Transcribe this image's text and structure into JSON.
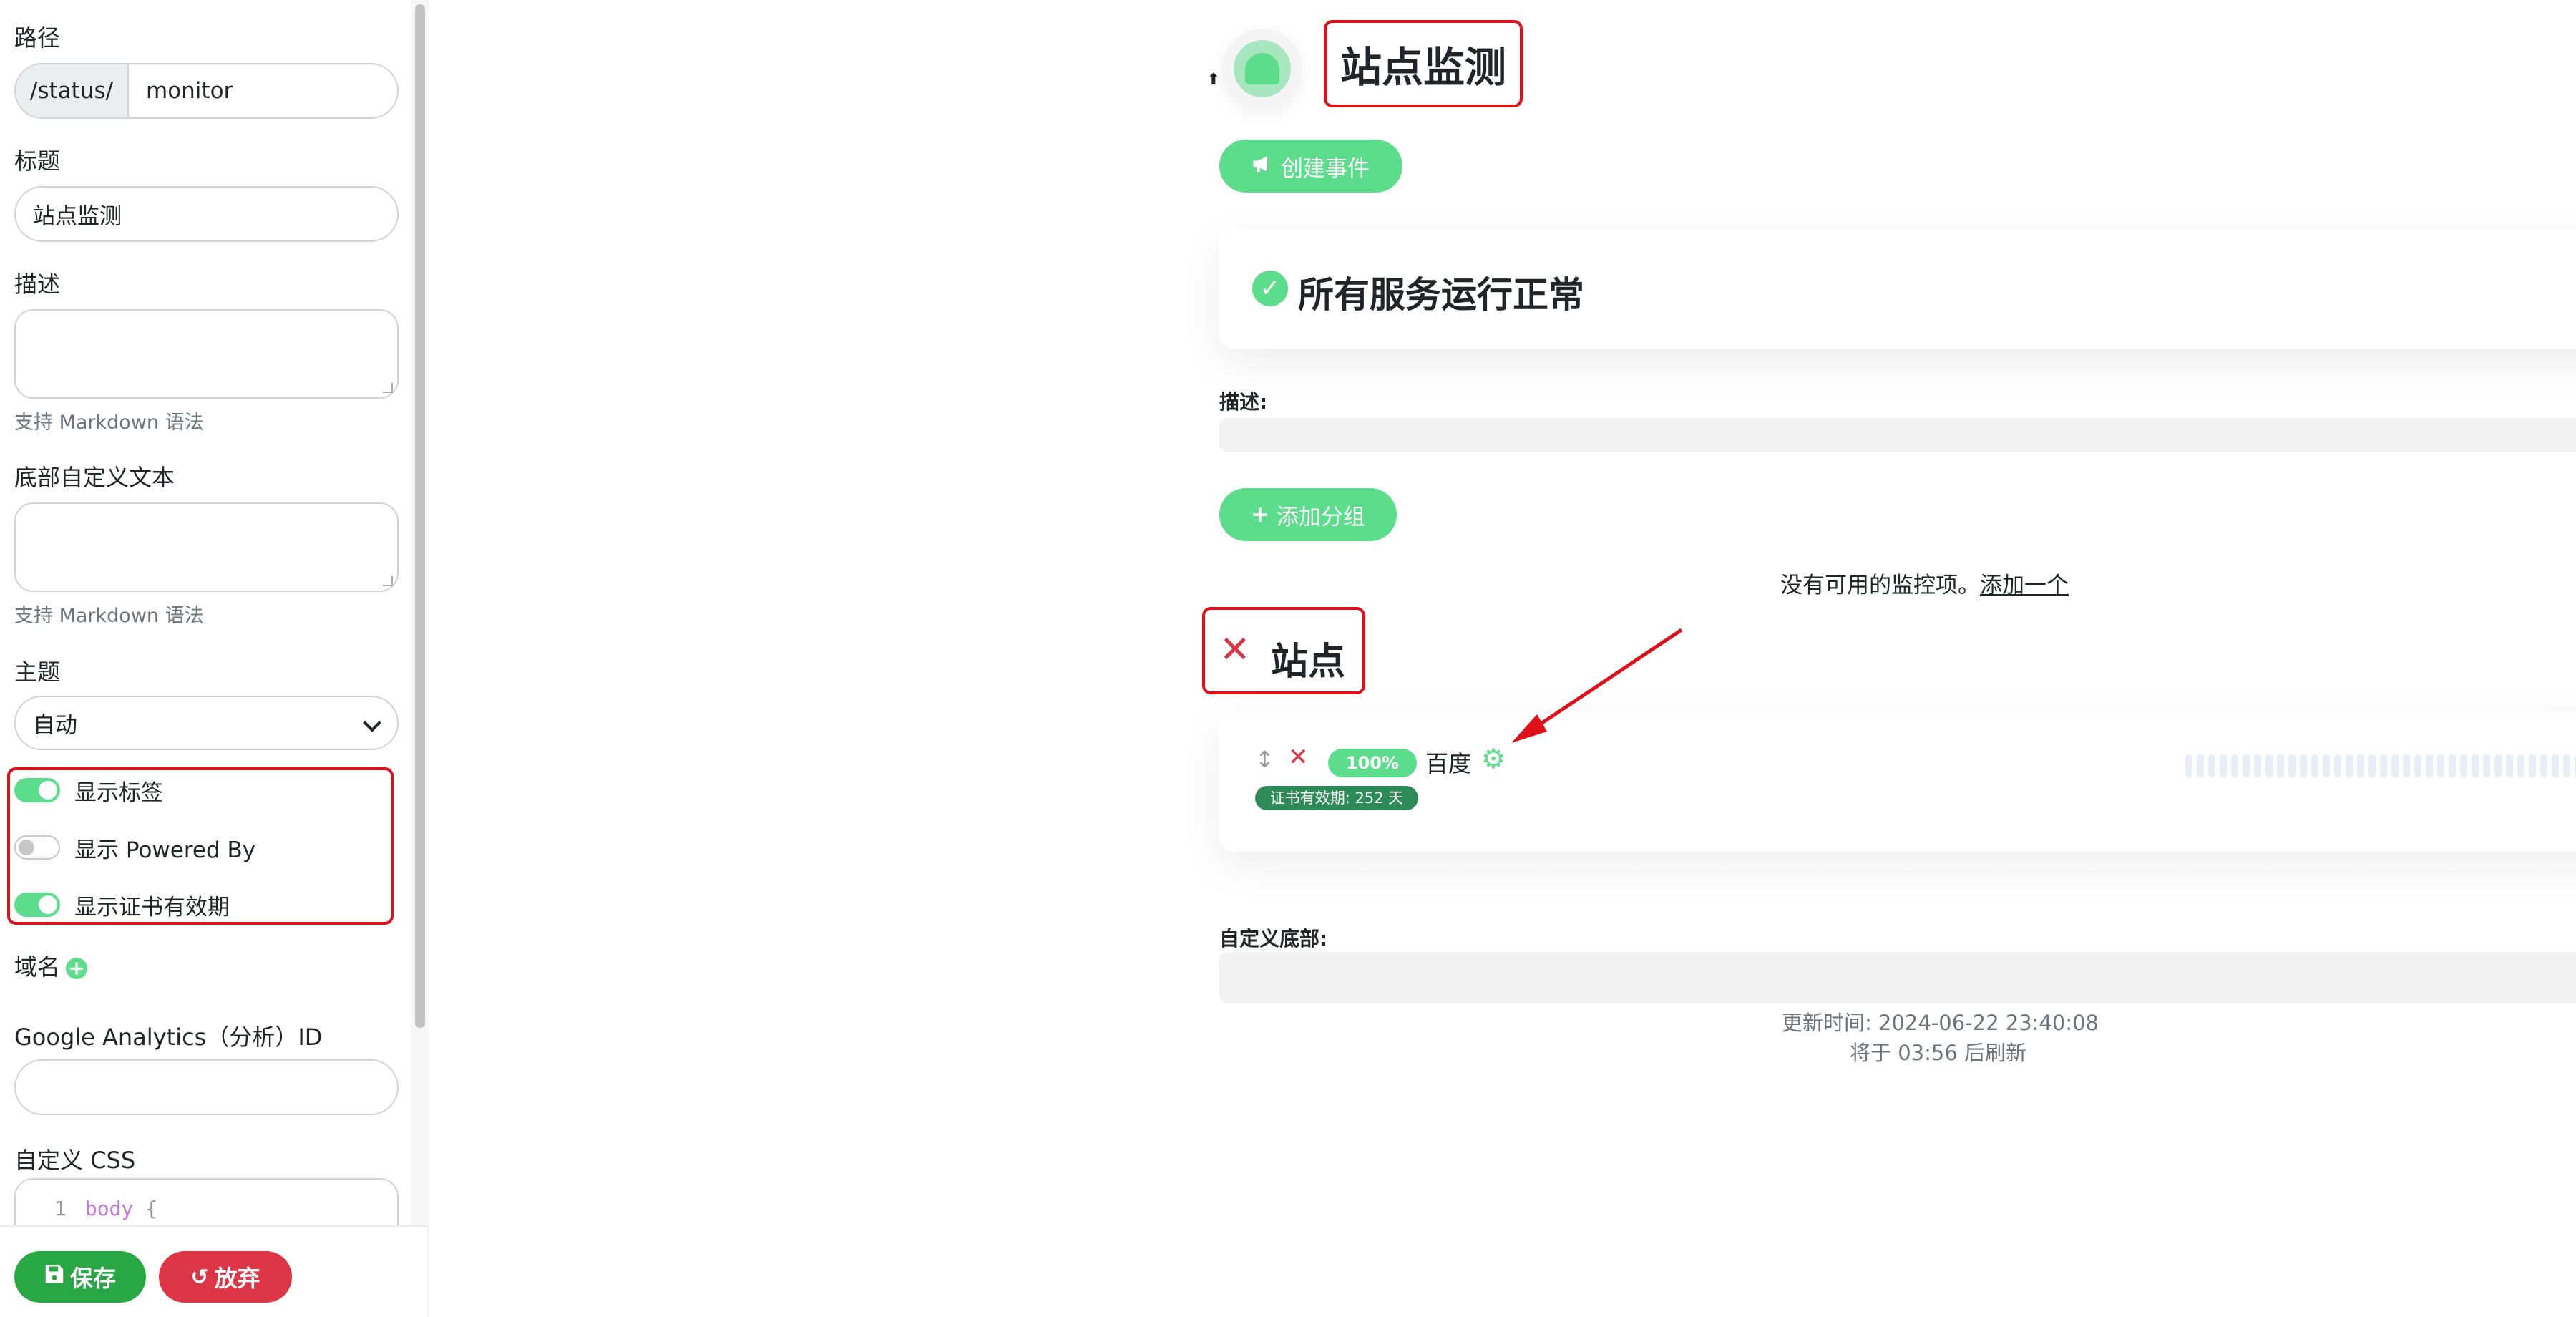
{
  "sidebar": {
    "path_label": "路径",
    "path_prefix": "/status/",
    "path_value": "monitor",
    "title_label": "标题",
    "title_value": "站点监测",
    "description_label": "描述",
    "description_help": "支持 Markdown 语法",
    "footer_text_label": "底部自定义文本",
    "footer_text_help": "支持 Markdown 语法",
    "theme_label": "主题",
    "theme_value": "自动",
    "toggles": [
      {
        "label": "显示标签",
        "on": true
      },
      {
        "label": "显示 Powered By",
        "on": false
      },
      {
        "label": "显示证书有效期",
        "on": true
      }
    ],
    "domain_label": "域名",
    "ga_label": "Google Analytics（分析）ID",
    "css_label": "自定义 CSS",
    "css_line_no": "1",
    "css_selector": "body",
    "css_brace": "{",
    "save_label": "保存",
    "discard_label": "放弃"
  },
  "main": {
    "title": "站点监测",
    "create_event_label": "创建事件",
    "status_text": "所有服务运行正常",
    "description_label": "描述:",
    "add_group_label": "添加分组",
    "empty_text": "没有可用的监控项。",
    "empty_link": "添加一个",
    "group_name": "站点",
    "monitor": {
      "uptime": "100%",
      "name": "百度",
      "cert_expiry": "证书有效期: 252 天"
    },
    "custom_footer_label": "自定义底部:",
    "updated_text": "更新时间: 2024-06-22 23:40:08",
    "refresh_text": "将于 03:56 后刷新"
  },
  "colors": {
    "accent": "#5cdd8b",
    "danger": "#dc3545",
    "save": "#28a745",
    "annotation": "#e0101b"
  },
  "icons": [
    "upload-icon",
    "bullhorn-icon",
    "check-circle-icon",
    "plus-icon",
    "x-icon",
    "drag-icon",
    "gear-icon",
    "save-icon",
    "undo-icon",
    "chevron-down-icon"
  ]
}
